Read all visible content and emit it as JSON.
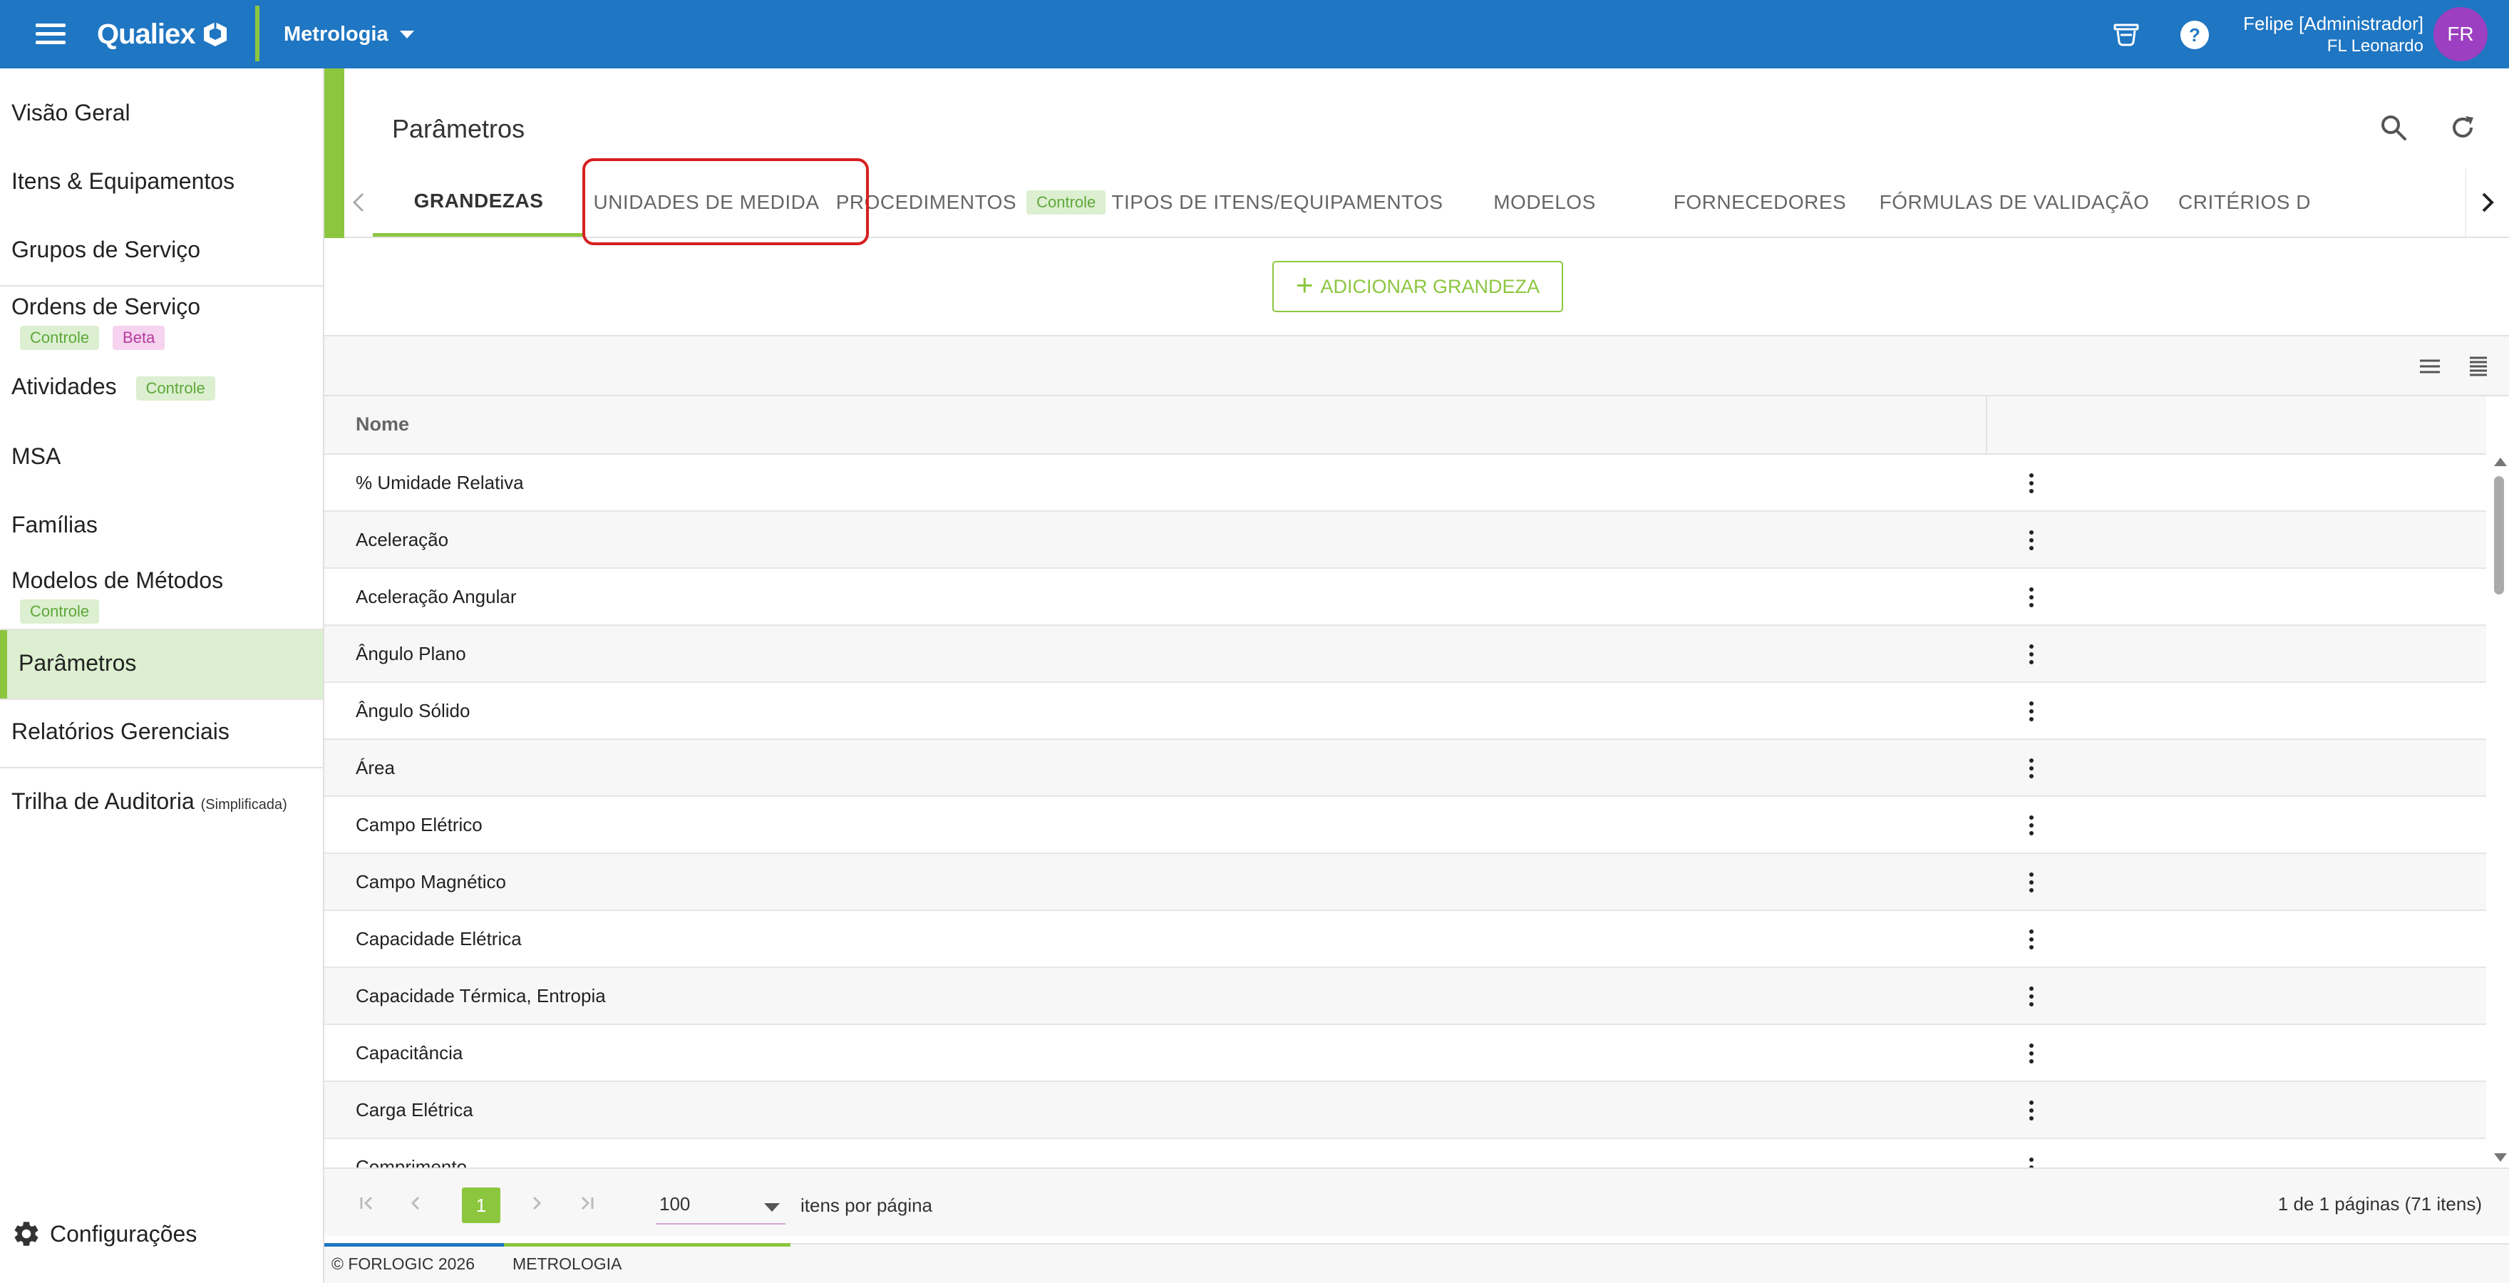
{
  "topbar": {
    "brand": "Qualiex",
    "module": "Metrologia",
    "user_name": "Felipe [Administrador]",
    "user_sub": "FL Leonardo",
    "avatar_initials": "FR",
    "colors": {
      "bar": "#1f76c2",
      "accent": "#8cc63f",
      "avatar": "#9c3fc0"
    }
  },
  "sidebar": {
    "items": [
      {
        "label": "Visão Geral"
      },
      {
        "label": "Itens & Equipamentos"
      },
      {
        "label": "Grupos de Serviço"
      },
      {
        "label": "Ordens de Serviço",
        "badges": [
          "Controle",
          "Beta"
        ]
      },
      {
        "label": "Atividades",
        "badges": [
          "Controle"
        ]
      },
      {
        "label": "MSA"
      },
      {
        "label": "Famílias"
      },
      {
        "label": "Modelos de Métodos",
        "badges": [
          "Controle"
        ]
      },
      {
        "label": "Parâmetros"
      },
      {
        "label": "Relatórios Gerenciais"
      },
      {
        "label": "Trilha de Auditoria",
        "note": "(Simplificada)"
      }
    ],
    "settings": "Configurações"
  },
  "page": {
    "title": "Parâmetros",
    "tabs": [
      {
        "label": "GRANDEZAS"
      },
      {
        "label": "UNIDADES DE MEDIDA"
      },
      {
        "label": "PROCEDIMENTOS",
        "badge": "Controle"
      },
      {
        "label": "TIPOS DE ITENS/EQUIPAMENTOS"
      },
      {
        "label": "MODELOS"
      },
      {
        "label": "FORNECEDORES"
      },
      {
        "label": "FÓRMULAS DE VALIDAÇÃO"
      },
      {
        "label": "CRITÉRIOS D"
      }
    ],
    "add_button": "ADICIONAR GRANDEZA"
  },
  "table": {
    "header_name": "Nome",
    "rows": [
      "% Umidade Relativa",
      "Aceleração",
      "Aceleração Angular",
      "Ângulo Plano",
      "Ângulo Sólido",
      "Área",
      "Campo Elétrico",
      "Campo Magnético",
      "Capacidade Elétrica",
      "Capacidade Térmica, Entropia",
      "Capacitância",
      "Carga Elétrica",
      "Comprimento"
    ]
  },
  "pager": {
    "current_page": "1",
    "page_size": "100",
    "per_page_label": "itens por página",
    "info": "1 de 1 páginas (71 itens)"
  },
  "footer": {
    "copyright": "© FORLOGIC 2026",
    "module": "METROLOGIA"
  }
}
